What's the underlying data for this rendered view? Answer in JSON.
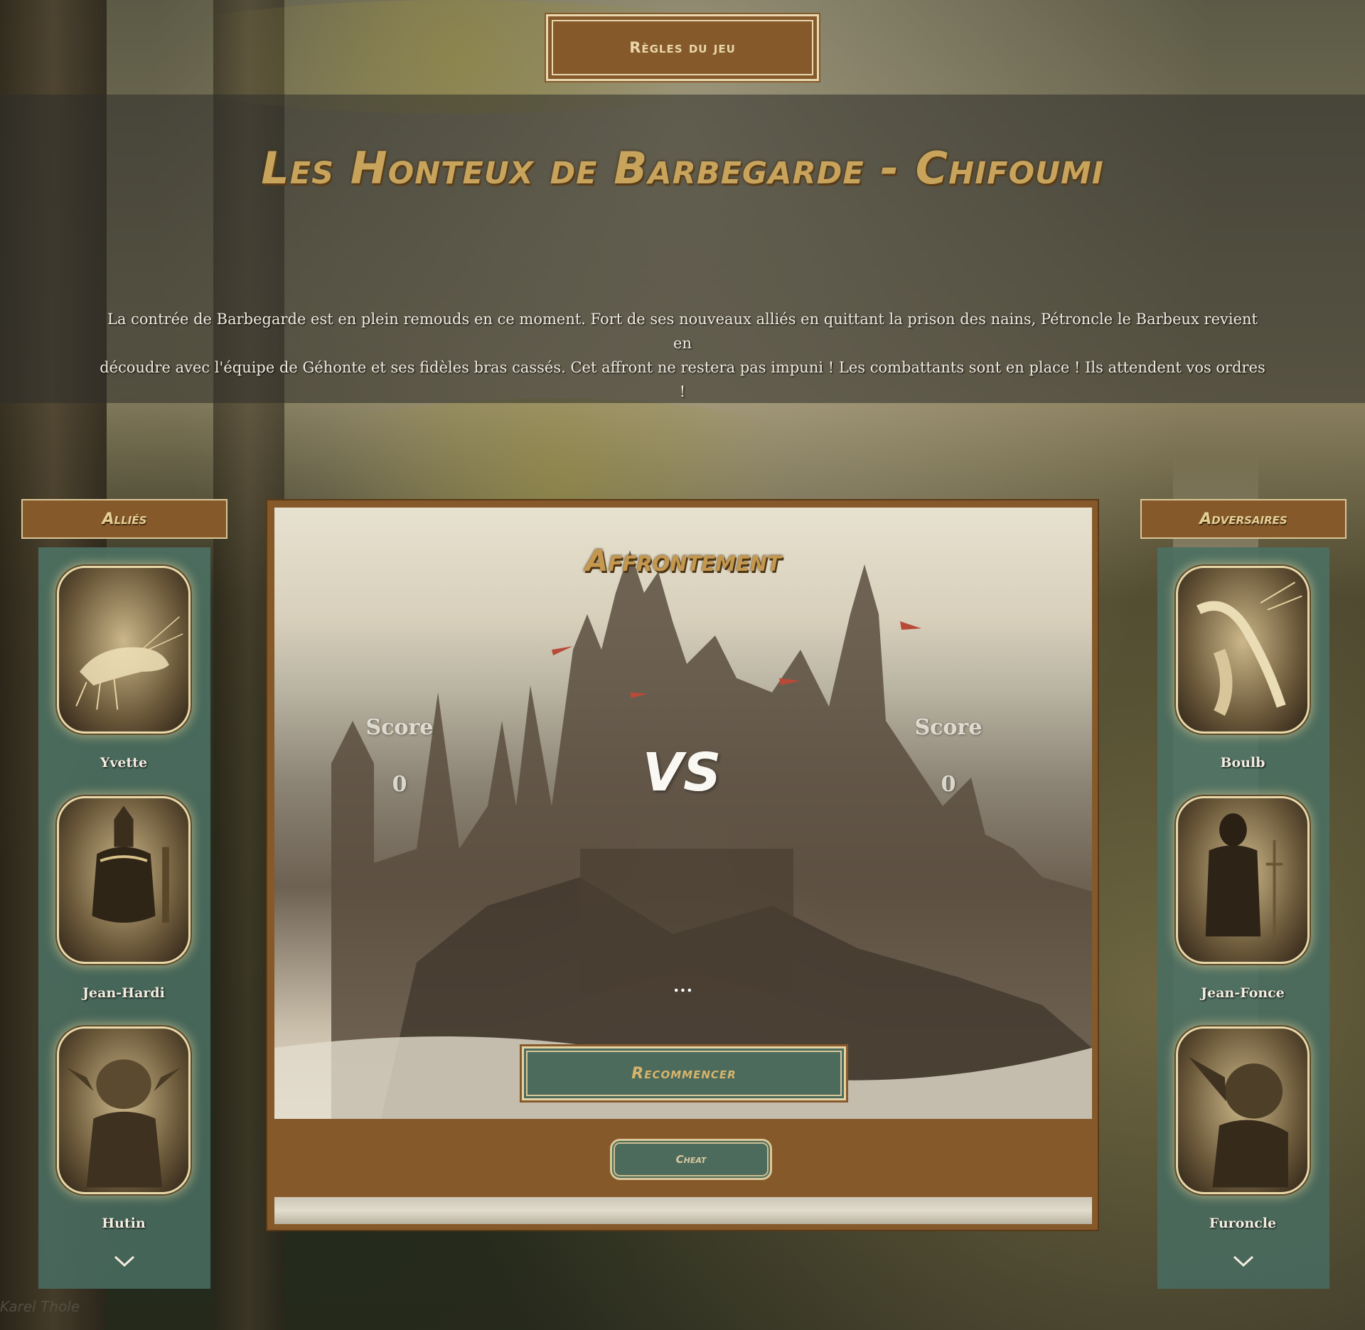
{
  "rules_button": {
    "label": "Règles du jeu"
  },
  "header": {
    "title": "Les Honteux de Barbegarde - Chifoumi",
    "intro_line1": "La contrée de Barbegarde est en plein remouds en ce moment. Fort de ses nouveaux alliés en quittant la prison des nains, Pétroncle le Barbeux revient en",
    "intro_line2": "découdre avec l'équipe de Géhonte et ses fidèles bras cassés. Cet affront ne restera pas impuni ! Les combattants sont en place ! Ils attendent vos ordres !"
  },
  "allies": {
    "label": "Alliés",
    "characters": [
      {
        "name": "Yvette",
        "icon": "shrimp-portrait"
      },
      {
        "name": "Jean-Hardi",
        "icon": "armored-knight-portrait"
      },
      {
        "name": "Hutin",
        "icon": "goblin-portrait"
      }
    ]
  },
  "adversaries": {
    "label": "Adversaires",
    "characters": [
      {
        "name": "Boulb",
        "icon": "lobster-portrait"
      },
      {
        "name": "Jean-Fonce",
        "icon": "dark-knight-portrait"
      },
      {
        "name": "Furoncle",
        "icon": "goblin-portrait"
      }
    ]
  },
  "arena": {
    "title": "Affrontement",
    "player_score_label": "Score",
    "player_score": "0",
    "opponent_score_label": "Score",
    "opponent_score": "0",
    "vs_label": "VS",
    "status": "...",
    "restart_button": "Recommencer",
    "cheat_button": "Cheat"
  },
  "credit": "Karel Thole",
  "colors": {
    "brown": "#86592b",
    "teal": "#4c6b5c",
    "gold": "#c7a35c",
    "cream": "#e8d9b0"
  }
}
